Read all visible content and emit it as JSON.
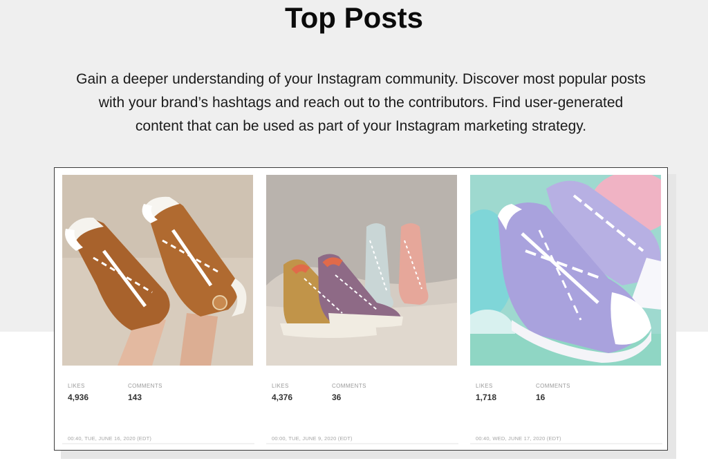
{
  "page": {
    "title": "Top Posts",
    "description": "Gain a deeper understanding of your Instagram community. Discover most popular posts with your brand’s hashtags and reach out to the contributors. Find user-generated content that can be used as part of your Instagram marketing strategy."
  },
  "posts": [
    {
      "image": "brown-high-top-sneakers-photo",
      "likes_label": "LIKES",
      "likes": "4,936",
      "comments_label": "COMMENTS",
      "comments": "143",
      "timestamp": "00:40, TUE, JUNE 16, 2020 (EDT)"
    },
    {
      "image": "four-colorful-sneakers-photo",
      "likes_label": "LIKES",
      "likes": "4,376",
      "comments_label": "COMMENTS",
      "comments": "36",
      "timestamp": "00:00, TUE, JUNE 9, 2020 (EDT)"
    },
    {
      "image": "lavender-low-top-sneakers-photo",
      "likes_label": "LIKES",
      "likes": "1,718",
      "comments_label": "COMMENTS",
      "comments": "16",
      "timestamp": "00:40, WED, JUNE 17, 2020 (EDT)"
    }
  ]
}
